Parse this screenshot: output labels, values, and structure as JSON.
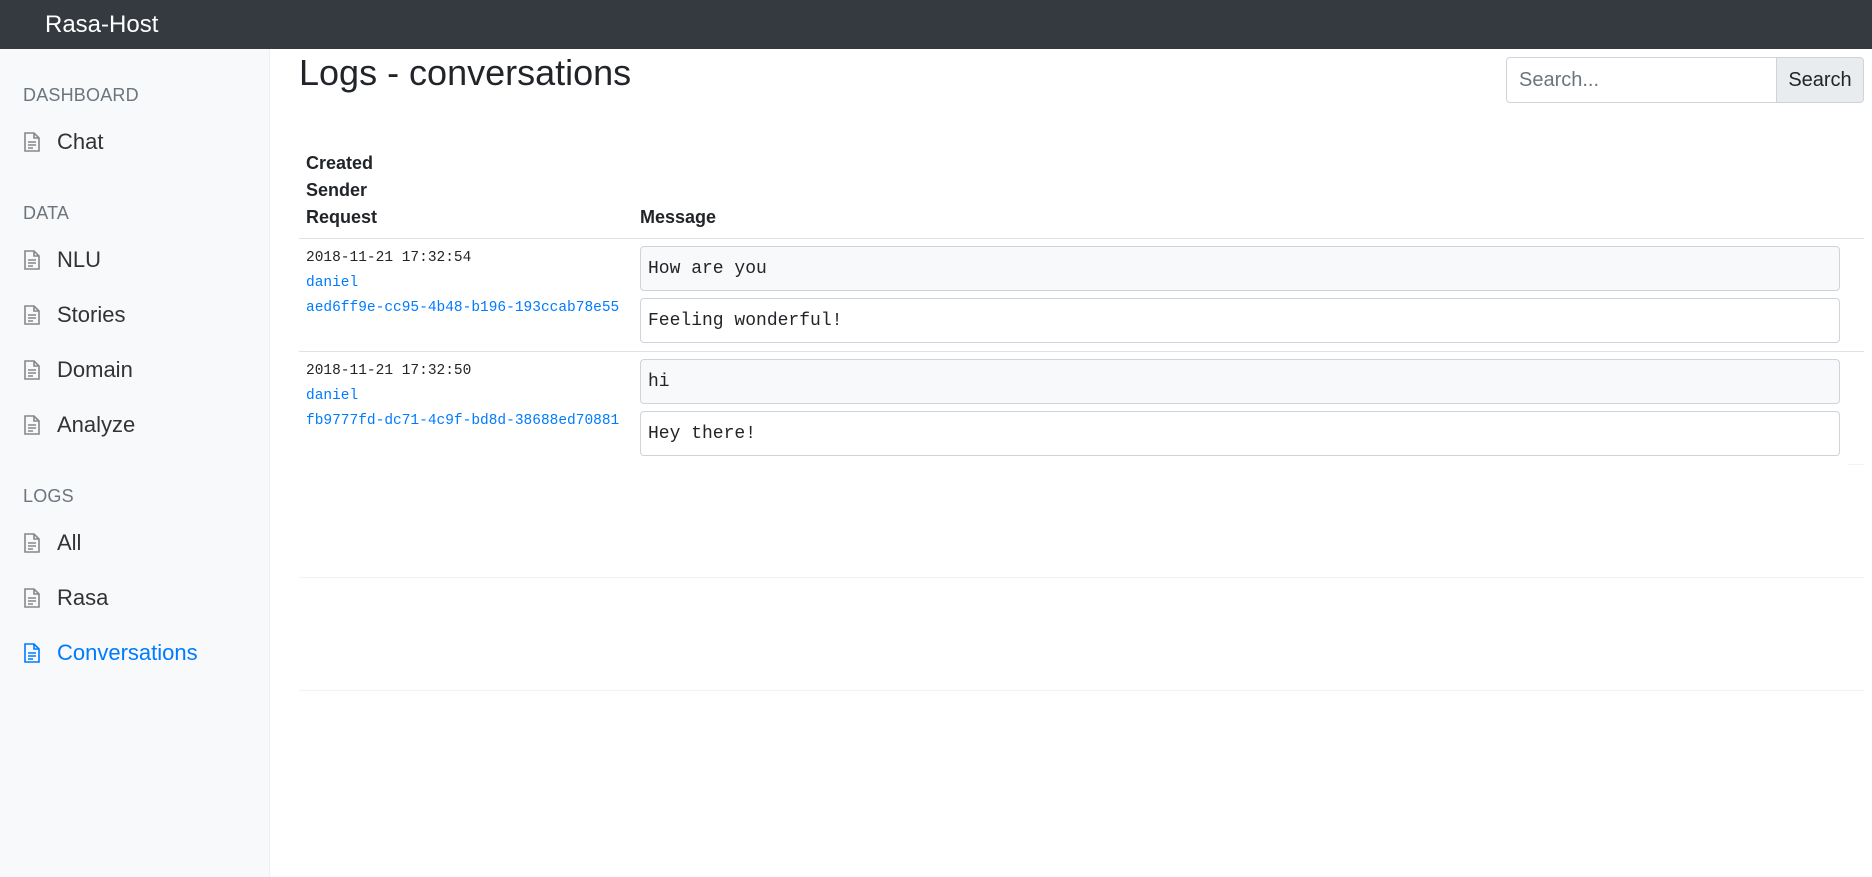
{
  "app": {
    "brand": "Rasa-Host"
  },
  "sidebar": {
    "sections": [
      {
        "heading": "DASHBOARD",
        "items": [
          {
            "label": "Chat",
            "icon": "document-icon",
            "active": false
          }
        ]
      },
      {
        "heading": "DATA",
        "items": [
          {
            "label": "NLU",
            "icon": "document-icon",
            "active": false
          },
          {
            "label": "Stories",
            "icon": "document-icon",
            "active": false
          },
          {
            "label": "Domain",
            "icon": "document-icon",
            "active": false
          },
          {
            "label": "Analyze",
            "icon": "document-icon",
            "active": false
          }
        ]
      },
      {
        "heading": "LOGS",
        "items": [
          {
            "label": "All",
            "icon": "document-icon",
            "active": false
          },
          {
            "label": "Rasa",
            "icon": "document-icon",
            "active": false
          },
          {
            "label": "Conversations",
            "icon": "document-icon",
            "active": true
          }
        ]
      }
    ]
  },
  "main": {
    "title": "Logs - conversations",
    "search": {
      "placeholder": "Search...",
      "value": "",
      "button_label": "Search"
    },
    "table": {
      "headers": {
        "created": "Created",
        "sender": "Sender",
        "request": "Request",
        "message": "Message"
      },
      "rows": [
        {
          "created": "2018-11-21 17:32:54",
          "sender": "daniel",
          "request": "aed6ff9e-cc95-4b48-b196-193ccab78e55",
          "user_message": "How are you",
          "bot_message": "Feeling wonderful!"
        },
        {
          "created": "2018-11-21 17:32:50",
          "sender": "daniel",
          "request": "fb9777fd-dc71-4c9f-bd8d-38688ed70881",
          "user_message": "hi",
          "bot_message": "Hey there!"
        }
      ]
    }
  },
  "colors": {
    "navbar": "#343a40",
    "active": "#007bff",
    "link": "#007bff"
  }
}
